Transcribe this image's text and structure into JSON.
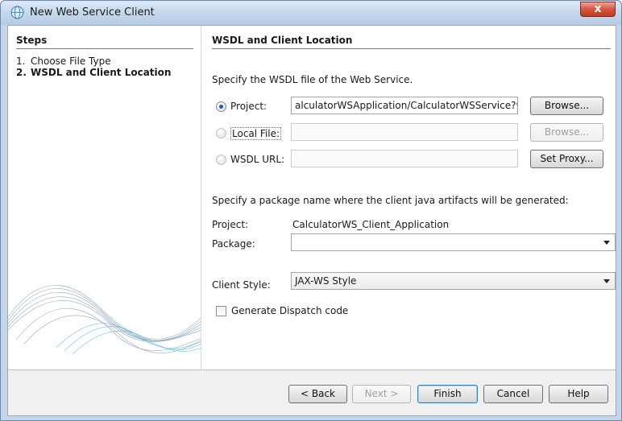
{
  "window": {
    "title": "New Web Service Client",
    "close_glyph": "x",
    "icon": "globe-icon"
  },
  "steps": {
    "title": "Steps",
    "items": [
      {
        "num": "1.",
        "label": "Choose File Type"
      },
      {
        "num": "2.",
        "label": "WSDL and Client Location"
      }
    ]
  },
  "section": {
    "title": "WSDL and Client Location",
    "description": "Specify the WSDL file of the Web Service."
  },
  "source": {
    "project_label": "Project:",
    "project_value": "alculatorWSApplication/CalculatorWSService?wsdl",
    "project_browse": "Browse...",
    "local_label": "Local File:",
    "local_value": "",
    "local_browse": "Browse...",
    "url_label": "WSDL URL:",
    "url_value": "",
    "set_proxy": "Set Proxy...",
    "selected": "project"
  },
  "package": {
    "description": "Specify a package name where the client java artifacts will be generated:",
    "project_label": "Project:",
    "project_name": "CalculatorWS_Client_Application",
    "package_label": "Package:",
    "package_value": ""
  },
  "client_style": {
    "label": "Client Style:",
    "value": "JAX-WS Style"
  },
  "dispatch": {
    "label": "Generate Dispatch code",
    "checked": false
  },
  "buttons": {
    "back": "< Back",
    "next": "Next >",
    "finish": "Finish",
    "cancel": "Cancel",
    "help": "Help"
  },
  "colors": {
    "title_bar": "#c3d6ec",
    "close_button": "#c43a20",
    "radio_selected": "#1f5fb3"
  }
}
